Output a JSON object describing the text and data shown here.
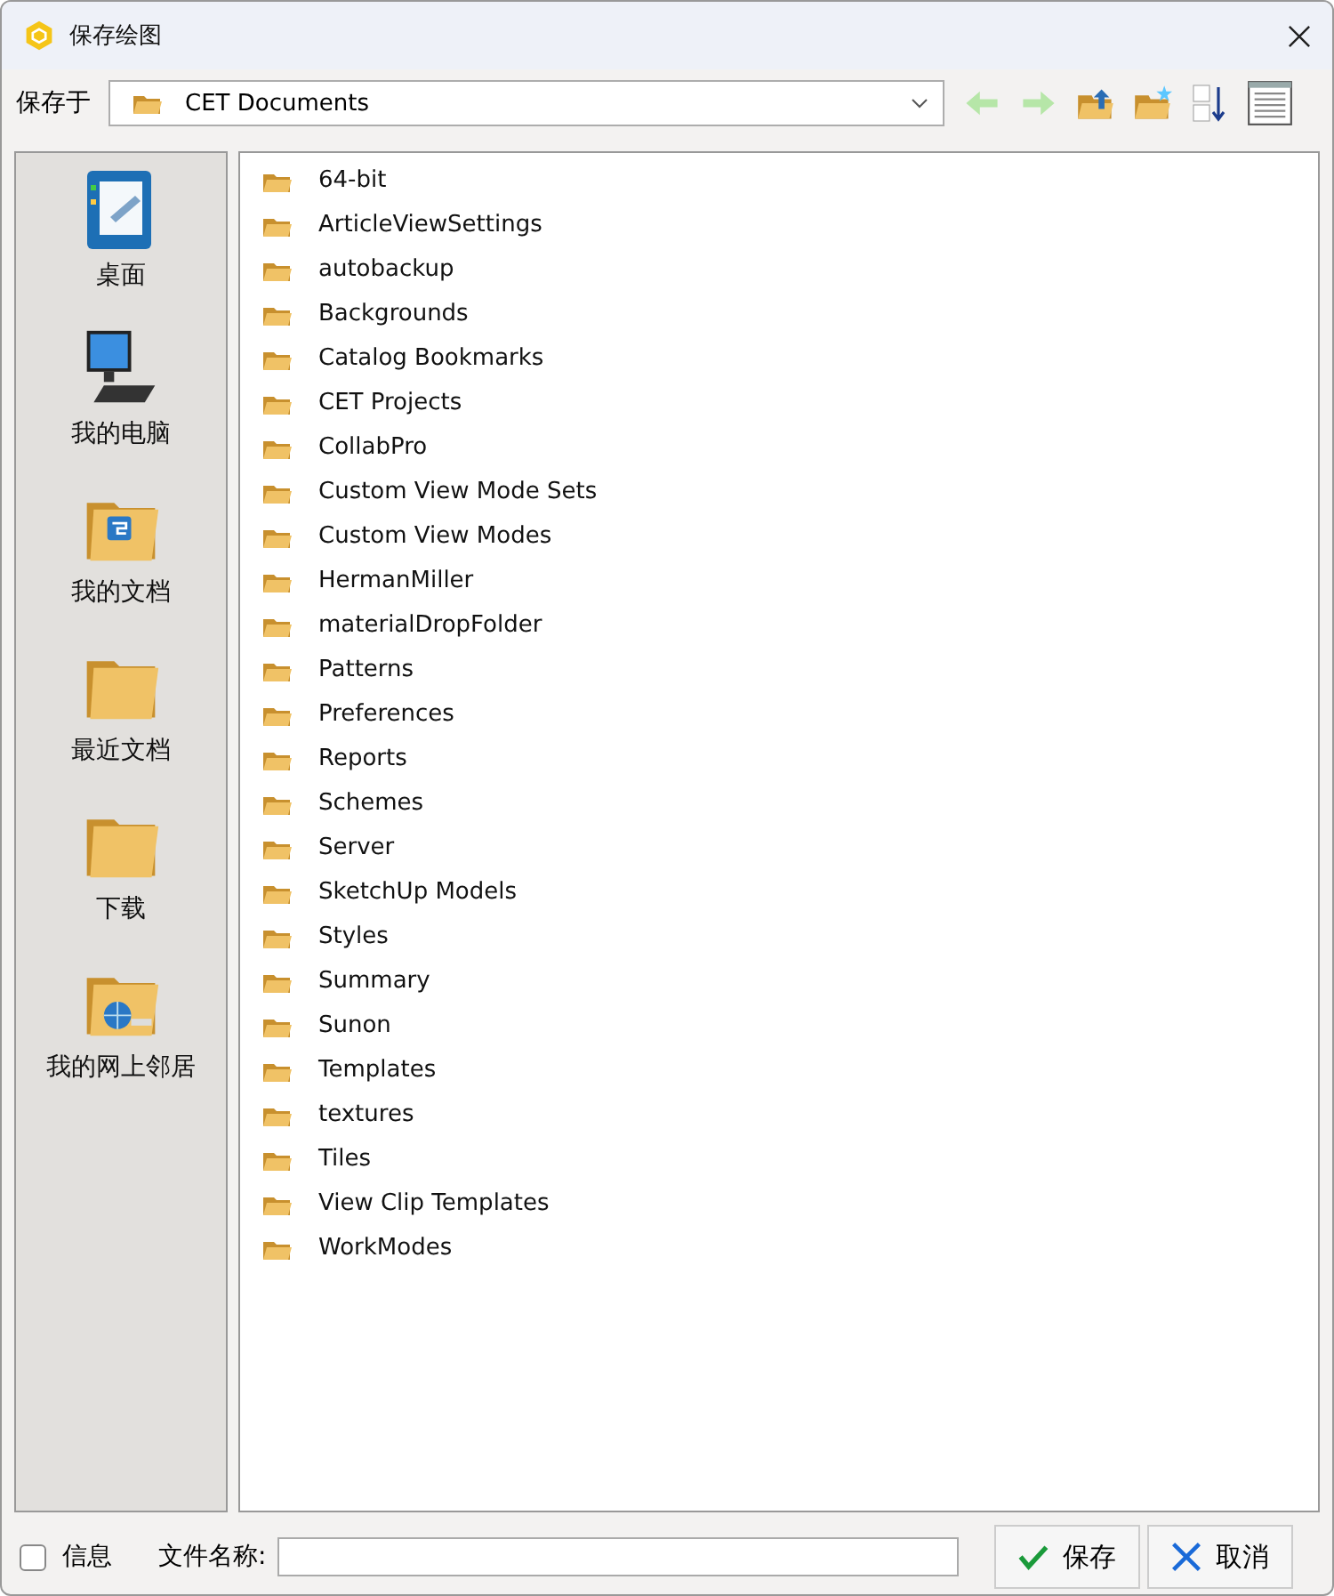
{
  "window": {
    "title": "保存绘图"
  },
  "location": {
    "label": "保存于",
    "value": "CET Documents"
  },
  "places": [
    {
      "label": "桌面",
      "kind": "desktop"
    },
    {
      "label": "我的电脑",
      "kind": "computer"
    },
    {
      "label": "我的文档",
      "kind": "documents"
    },
    {
      "label": "最近文档",
      "kind": "folder"
    },
    {
      "label": "下载",
      "kind": "folder"
    },
    {
      "label": "我的网上邻居",
      "kind": "network"
    }
  ],
  "files": [
    "64-bit",
    "ArticleViewSettings",
    "autobackup",
    "Backgrounds",
    "Catalog Bookmarks",
    "CET Projects",
    "CollabPro",
    "Custom View Mode Sets",
    "Custom View Modes",
    "HermanMiller",
    "materialDropFolder",
    "Patterns",
    "Preferences",
    "Reports",
    "Schemes",
    "Server",
    "SketchUp Models",
    "Styles",
    "Summary",
    "Sunon",
    "Templates",
    "textures",
    "Tiles",
    "View Clip Templates",
    "WorkModes"
  ],
  "info": {
    "label": "信息",
    "checked": false
  },
  "filename": {
    "label": "文件名称:"
  },
  "buttons": [
    {
      "label": "保存",
      "kind": "save"
    },
    {
      "label": "取消",
      "kind": "cancel"
    }
  ]
}
